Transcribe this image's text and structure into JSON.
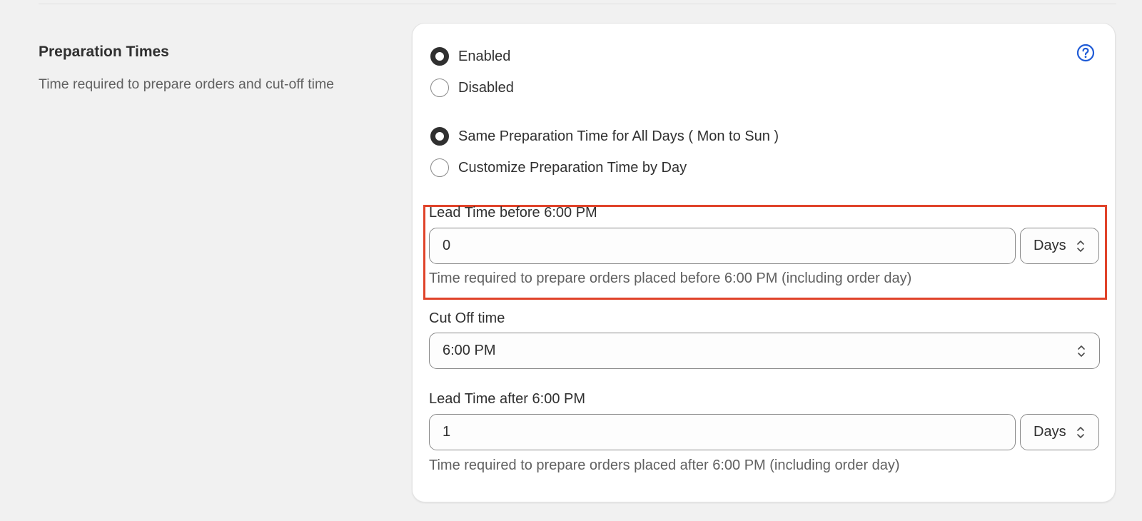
{
  "section": {
    "title": "Preparation Times",
    "description": "Time required to prepare orders and cut-off time"
  },
  "status_options": [
    {
      "label": "Enabled",
      "checked": true
    },
    {
      "label": "Disabled",
      "checked": false
    }
  ],
  "mode_options": [
    {
      "label": "Same Preparation Time for All Days ( Mon to Sun )",
      "checked": true
    },
    {
      "label": "Customize Preparation Time by Day",
      "checked": false
    }
  ],
  "lead_before": {
    "label": "Lead Time before 6:00 PM",
    "value": "0",
    "unit": "Days",
    "help": "Time required to prepare orders placed before 6:00 PM (including order day)"
  },
  "cutoff": {
    "label": "Cut Off time",
    "value": "6:00 PM"
  },
  "lead_after": {
    "label": "Lead Time after 6:00 PM",
    "value": "1",
    "unit": "Days",
    "help": "Time required to prepare orders placed after 6:00 PM (including order day)"
  },
  "colors": {
    "highlight": "#e0432a",
    "help_icon": "#1f5bd6",
    "background": "#f1f1f1"
  },
  "icons": {
    "help": "question-circle-icon",
    "select": "chevron-up-down-icon"
  }
}
